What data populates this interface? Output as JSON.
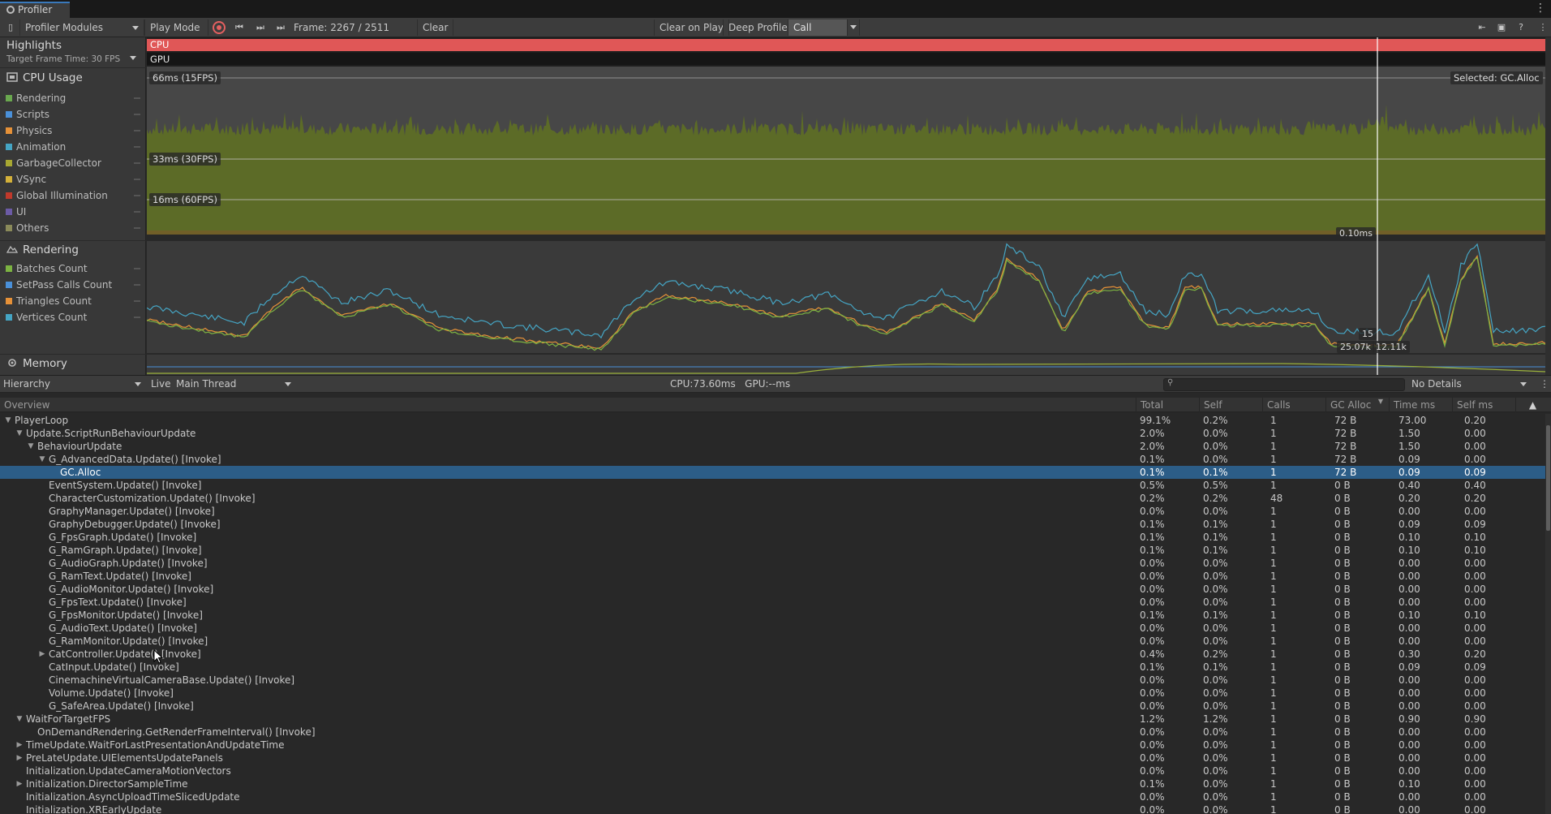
{
  "window": {
    "tab_label": "Profiler"
  },
  "toolbar": {
    "modules_label": "Profiler Modules",
    "play_mode_label": "Play Mode",
    "frame_text": "Frame: 2267 / 2511",
    "clear_label": "Clear",
    "clear_on_play_label": "Clear on Play",
    "deep_profile_label": "Deep Profile",
    "call_stacks_label": "Call Stacks"
  },
  "sidebar": {
    "highlights_title": "Highlights",
    "target_frame_time": "Target Frame Time: 30 FPS",
    "cpu_title": "CPU Usage",
    "cpu_items": [
      {
        "label": "Rendering",
        "color": "#6aa84f"
      },
      {
        "label": "Scripts",
        "color": "#4a90d9"
      },
      {
        "label": "Physics",
        "color": "#e69138"
      },
      {
        "label": "Animation",
        "color": "#45a5c4"
      },
      {
        "label": "GarbageCollector",
        "color": "#a8a832"
      },
      {
        "label": "VSync",
        "color": "#d4b13a"
      },
      {
        "label": "Global Illumination",
        "color": "#c0392b"
      },
      {
        "label": "UI",
        "color": "#6c5ba6"
      },
      {
        "label": "Others",
        "color": "#8a8a5a"
      }
    ],
    "rendering_title": "Rendering",
    "rendering_items": [
      {
        "label": "Batches Count",
        "color": "#7cb342"
      },
      {
        "label": "SetPass Calls Count",
        "color": "#4a90d9"
      },
      {
        "label": "Triangles Count",
        "color": "#e69138"
      },
      {
        "label": "Vertices Count",
        "color": "#45a5c4"
      }
    ],
    "memory_title": "Memory"
  },
  "charts": {
    "highlight_cpu": "CPU",
    "highlight_gpu": "GPU",
    "line_66": "66ms (15FPS)",
    "line_33": "33ms (30FPS)",
    "line_16": "16ms (60FPS)",
    "selected_label": "Selected: GC.Alloc",
    "gc_value": "0.10ms",
    "render_val_1": "15",
    "render_val_2": "25.07k",
    "render_val_3": "12.11k",
    "cpu_fill_color": "#5c6b27",
    "highlight_color": "#e05757"
  },
  "hierarchy_bar": {
    "view_label": "Hierarchy",
    "live_label": "Live",
    "thread_label": "Main Thread",
    "timing_text": "CPU:73.60ms   GPU:--ms",
    "details_label": "No Details"
  },
  "table": {
    "columns": [
      "Overview",
      "Total",
      "Self",
      "Calls",
      "GC Alloc",
      "Time ms",
      "Self ms"
    ],
    "rows": [
      {
        "name": "PlayerLoop",
        "depth": 0,
        "expander": "open",
        "total": "99.1%",
        "self": "0.2%",
        "calls": "1",
        "gc": "72 B",
        "time": "73.00",
        "selfms": "0.20"
      },
      {
        "name": "Update.ScriptRunBehaviourUpdate",
        "depth": 1,
        "expander": "open",
        "total": "2.0%",
        "self": "0.0%",
        "calls": "1",
        "gc": "72 B",
        "time": "1.50",
        "selfms": "0.00"
      },
      {
        "name": "BehaviourUpdate",
        "depth": 2,
        "expander": "open",
        "total": "2.0%",
        "self": "0.0%",
        "calls": "1",
        "gc": "72 B",
        "time": "1.50",
        "selfms": "0.00"
      },
      {
        "name": "G_AdvancedData.Update() [Invoke]",
        "depth": 3,
        "expander": "open",
        "total": "0.1%",
        "self": "0.0%",
        "calls": "1",
        "gc": "72 B",
        "time": "0.09",
        "selfms": "0.00"
      },
      {
        "name": "GC.Alloc",
        "depth": 4,
        "expander": "none",
        "total": "0.1%",
        "self": "0.1%",
        "calls": "1",
        "gc": "72 B",
        "time": "0.09",
        "selfms": "0.09",
        "selected": true
      },
      {
        "name": "EventSystem.Update() [Invoke]",
        "depth": 3,
        "expander": "none",
        "total": "0.5%",
        "self": "0.5%",
        "calls": "1",
        "gc": "0 B",
        "time": "0.40",
        "selfms": "0.40"
      },
      {
        "name": "CharacterCustomization.Update() [Invoke]",
        "depth": 3,
        "expander": "none",
        "total": "0.2%",
        "self": "0.2%",
        "calls": "48",
        "gc": "0 B",
        "time": "0.20",
        "selfms": "0.20"
      },
      {
        "name": "GraphyManager.Update() [Invoke]",
        "depth": 3,
        "expander": "none",
        "total": "0.0%",
        "self": "0.0%",
        "calls": "1",
        "gc": "0 B",
        "time": "0.00",
        "selfms": "0.00"
      },
      {
        "name": "GraphyDebugger.Update() [Invoke]",
        "depth": 3,
        "expander": "none",
        "total": "0.1%",
        "self": "0.1%",
        "calls": "1",
        "gc": "0 B",
        "time": "0.09",
        "selfms": "0.09"
      },
      {
        "name": "G_FpsGraph.Update() [Invoke]",
        "depth": 3,
        "expander": "none",
        "total": "0.1%",
        "self": "0.1%",
        "calls": "1",
        "gc": "0 B",
        "time": "0.10",
        "selfms": "0.10"
      },
      {
        "name": "G_RamGraph.Update() [Invoke]",
        "depth": 3,
        "expander": "none",
        "total": "0.1%",
        "self": "0.1%",
        "calls": "1",
        "gc": "0 B",
        "time": "0.10",
        "selfms": "0.10"
      },
      {
        "name": "G_AudioGraph.Update() [Invoke]",
        "depth": 3,
        "expander": "none",
        "total": "0.0%",
        "self": "0.0%",
        "calls": "1",
        "gc": "0 B",
        "time": "0.00",
        "selfms": "0.00"
      },
      {
        "name": "G_RamText.Update() [Invoke]",
        "depth": 3,
        "expander": "none",
        "total": "0.0%",
        "self": "0.0%",
        "calls": "1",
        "gc": "0 B",
        "time": "0.00",
        "selfms": "0.00"
      },
      {
        "name": "G_AudioMonitor.Update() [Invoke]",
        "depth": 3,
        "expander": "none",
        "total": "0.0%",
        "self": "0.0%",
        "calls": "1",
        "gc": "0 B",
        "time": "0.00",
        "selfms": "0.00"
      },
      {
        "name": "G_FpsText.Update() [Invoke]",
        "depth": 3,
        "expander": "none",
        "total": "0.0%",
        "self": "0.0%",
        "calls": "1",
        "gc": "0 B",
        "time": "0.00",
        "selfms": "0.00"
      },
      {
        "name": "G_FpsMonitor.Update() [Invoke]",
        "depth": 3,
        "expander": "none",
        "total": "0.1%",
        "self": "0.1%",
        "calls": "1",
        "gc": "0 B",
        "time": "0.10",
        "selfms": "0.10"
      },
      {
        "name": "G_AudioText.Update() [Invoke]",
        "depth": 3,
        "expander": "none",
        "total": "0.0%",
        "self": "0.0%",
        "calls": "1",
        "gc": "0 B",
        "time": "0.00",
        "selfms": "0.00"
      },
      {
        "name": "G_RamMonitor.Update() [Invoke]",
        "depth": 3,
        "expander": "none",
        "total": "0.0%",
        "self": "0.0%",
        "calls": "1",
        "gc": "0 B",
        "time": "0.00",
        "selfms": "0.00"
      },
      {
        "name": "CatController.Update() [Invoke]",
        "depth": 3,
        "expander": "closed",
        "total": "0.4%",
        "self": "0.2%",
        "calls": "1",
        "gc": "0 B",
        "time": "0.30",
        "selfms": "0.20"
      },
      {
        "name": "CatInput.Update() [Invoke]",
        "depth": 3,
        "expander": "none",
        "total": "0.1%",
        "self": "0.1%",
        "calls": "1",
        "gc": "0 B",
        "time": "0.09",
        "selfms": "0.09"
      },
      {
        "name": "CinemachineVirtualCameraBase.Update() [Invoke]",
        "depth": 3,
        "expander": "none",
        "total": "0.0%",
        "self": "0.0%",
        "calls": "1",
        "gc": "0 B",
        "time": "0.00",
        "selfms": "0.00"
      },
      {
        "name": "Volume.Update() [Invoke]",
        "depth": 3,
        "expander": "none",
        "total": "0.0%",
        "self": "0.0%",
        "calls": "1",
        "gc": "0 B",
        "time": "0.00",
        "selfms": "0.00"
      },
      {
        "name": "G_SafeArea.Update() [Invoke]",
        "depth": 3,
        "expander": "none",
        "total": "0.0%",
        "self": "0.0%",
        "calls": "1",
        "gc": "0 B",
        "time": "0.00",
        "selfms": "0.00"
      },
      {
        "name": "WaitForTargetFPS",
        "depth": 1,
        "expander": "open",
        "total": "1.2%",
        "self": "1.2%",
        "calls": "1",
        "gc": "0 B",
        "time": "0.90",
        "selfms": "0.90"
      },
      {
        "name": "OnDemandRendering.GetRenderFrameInterval() [Invoke]",
        "depth": 2,
        "expander": "none",
        "total": "0.0%",
        "self": "0.0%",
        "calls": "1",
        "gc": "0 B",
        "time": "0.00",
        "selfms": "0.00"
      },
      {
        "name": "TimeUpdate.WaitForLastPresentationAndUpdateTime",
        "depth": 1,
        "expander": "closed",
        "total": "0.0%",
        "self": "0.0%",
        "calls": "1",
        "gc": "0 B",
        "time": "0.00",
        "selfms": "0.00"
      },
      {
        "name": "PreLateUpdate.UIElementsUpdatePanels",
        "depth": 1,
        "expander": "closed",
        "total": "0.0%",
        "self": "0.0%",
        "calls": "1",
        "gc": "0 B",
        "time": "0.00",
        "selfms": "0.00"
      },
      {
        "name": "Initialization.UpdateCameraMotionVectors",
        "depth": 1,
        "expander": "none",
        "total": "0.0%",
        "self": "0.0%",
        "calls": "1",
        "gc": "0 B",
        "time": "0.00",
        "selfms": "0.00"
      },
      {
        "name": "Initialization.DirectorSampleTime",
        "depth": 1,
        "expander": "closed",
        "total": "0.1%",
        "self": "0.0%",
        "calls": "1",
        "gc": "0 B",
        "time": "0.10",
        "selfms": "0.00"
      },
      {
        "name": "Initialization.AsyncUploadTimeSlicedUpdate",
        "depth": 1,
        "expander": "none",
        "total": "0.0%",
        "self": "0.0%",
        "calls": "1",
        "gc": "0 B",
        "time": "0.00",
        "selfms": "0.00"
      },
      {
        "name": "Initialization.XREarlyUpdate",
        "depth": 1,
        "expander": "none",
        "total": "0.0%",
        "self": "0.0%",
        "calls": "1",
        "gc": "0 B",
        "time": "0.00",
        "selfms": "0.00"
      }
    ]
  }
}
